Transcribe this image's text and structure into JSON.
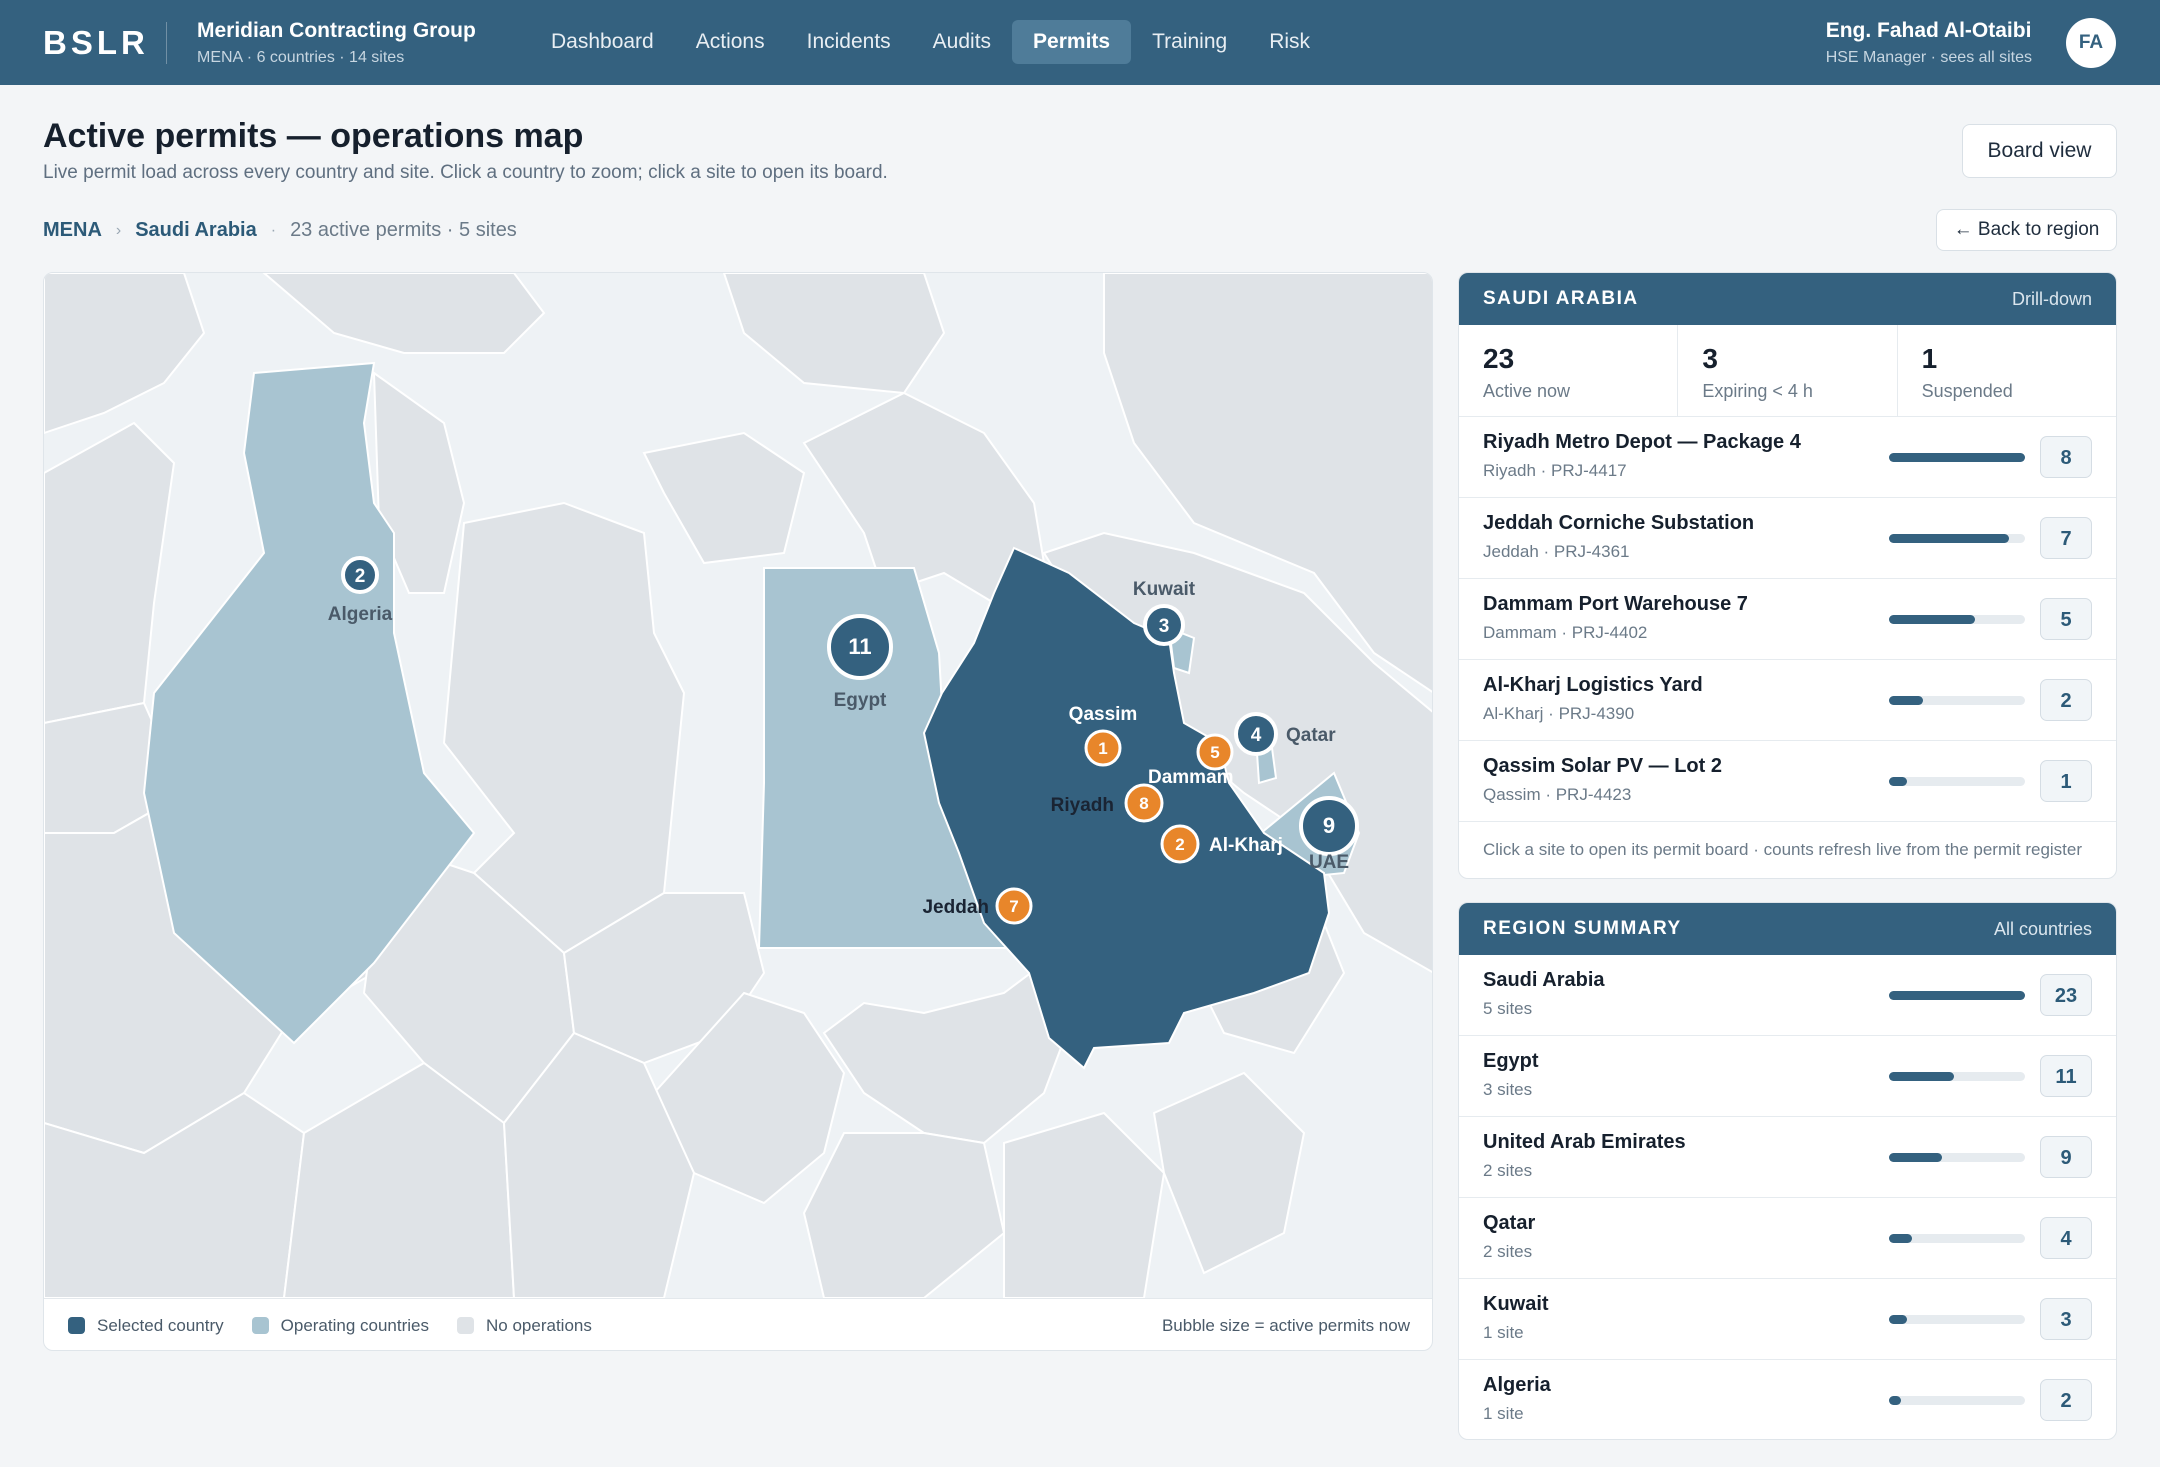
{
  "app": {
    "brand": "BSLR",
    "org_name": "Meridian Contracting Group",
    "org_sub": "MENA · 6 countries · 14 sites"
  },
  "nav": [
    {
      "label": "Dashboard",
      "active": false
    },
    {
      "label": "Actions",
      "active": false
    },
    {
      "label": "Incidents",
      "active": false
    },
    {
      "label": "Audits",
      "active": false
    },
    {
      "label": "Permits",
      "active": true
    },
    {
      "label": "Training",
      "active": false
    },
    {
      "label": "Risk",
      "active": false
    }
  ],
  "user": {
    "name": "Eng. Fahad Al-Otaibi",
    "role": "HSE Manager · sees all sites",
    "initials": "FA"
  },
  "header": {
    "title": "Active permits — operations map",
    "subtitle": "Live permit load across every country and site. Click a country to zoom; click a site to open its board.",
    "board_view": "Board view",
    "back": "← Back to region"
  },
  "breadcrumb": {
    "root": "MENA",
    "current": "Saudi Arabia",
    "meta": "23 active permits · 5 sites"
  },
  "map": {
    "countries": [
      {
        "name": "Algeria",
        "count": "2"
      },
      {
        "name": "Egypt",
        "count": "11"
      },
      {
        "name": "Kuwait",
        "count": "3"
      },
      {
        "name": "Qatar",
        "count": "4"
      },
      {
        "name": "UAE",
        "count": "9"
      }
    ],
    "sites": [
      {
        "name": "Qassim",
        "count": "1"
      },
      {
        "name": "Dammam",
        "count": "5"
      },
      {
        "name": "Riyadh",
        "count": "8"
      },
      {
        "name": "Al-Kharj",
        "count": "2"
      },
      {
        "name": "Jeddah",
        "count": "7"
      }
    ],
    "legend": {
      "selected": "Selected country",
      "operating": "Operating countries",
      "none": "No operations",
      "note": "Bubble size = active permits now"
    },
    "colors": {
      "selected": "#34617f",
      "operating": "#a8c4d1",
      "none": "#dfe3e7",
      "site": "#e8862a"
    }
  },
  "drilldown": {
    "title": "SAUDI ARABIA",
    "tag": "Drill-down",
    "stats": [
      {
        "value": "23",
        "label": "Active now"
      },
      {
        "value": "3",
        "label": "Expiring < 4 h"
      },
      {
        "value": "1",
        "label": "Suspended"
      }
    ],
    "sites": [
      {
        "name": "Riyadh Metro Depot — Package 4",
        "sub": "Riyadh · PRJ-4417",
        "count": "8",
        "fill": 1.0
      },
      {
        "name": "Jeddah Corniche Substation",
        "sub": "Jeddah · PRJ-4361",
        "count": "7",
        "fill": 0.88
      },
      {
        "name": "Dammam Port Warehouse 7",
        "sub": "Dammam · PRJ-4402",
        "count": "5",
        "fill": 0.63
      },
      {
        "name": "Al-Kharj Logistics Yard",
        "sub": "Al-Kharj · PRJ-4390",
        "count": "2",
        "fill": 0.25
      },
      {
        "name": "Qassim Solar PV — Lot 2",
        "sub": "Qassim · PRJ-4423",
        "count": "1",
        "fill": 0.13
      }
    ],
    "footer": "Click a site to open its permit board · counts refresh live from the permit register"
  },
  "summary": {
    "title": "REGION SUMMARY",
    "tag": "All countries",
    "rows": [
      {
        "name": "Saudi Arabia",
        "sub": "5 sites",
        "count": "23",
        "fill": 1.0
      },
      {
        "name": "Egypt",
        "sub": "3 sites",
        "count": "11",
        "fill": 0.48
      },
      {
        "name": "United Arab Emirates",
        "sub": "2 sites",
        "count": "9",
        "fill": 0.39
      },
      {
        "name": "Qatar",
        "sub": "2 sites",
        "count": "4",
        "fill": 0.17
      },
      {
        "name": "Kuwait",
        "sub": "1 site",
        "count": "3",
        "fill": 0.13
      },
      {
        "name": "Algeria",
        "sub": "1 site",
        "count": "2",
        "fill": 0.09
      }
    ]
  }
}
